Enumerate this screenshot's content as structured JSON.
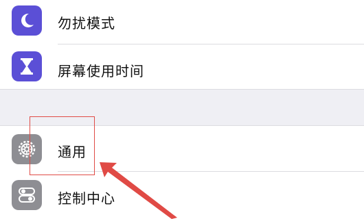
{
  "settings": {
    "items": [
      {
        "label": "勿扰模式",
        "icon": "moon-icon",
        "color": "#5b4fd6"
      },
      {
        "label": "屏幕使用时间",
        "icon": "hourglass-icon",
        "color": "#5b4fd6"
      },
      {
        "label": "通用",
        "icon": "gear-icon",
        "color": "#8e8e93"
      },
      {
        "label": "控制中心",
        "icon": "toggles-icon",
        "color": "#8e8e93"
      }
    ]
  },
  "annotation": {
    "color": "#e04a45"
  }
}
